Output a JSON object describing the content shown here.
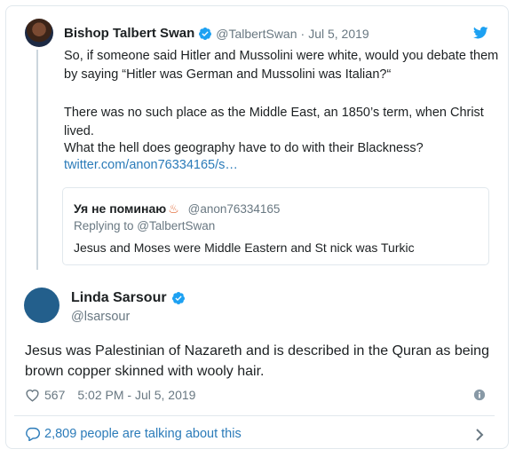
{
  "parent_tweet": {
    "name": "Bishop Talbert Swan",
    "handle": "@TalbertSwan",
    "separator": "·",
    "date": "Jul 5, 2019",
    "paragraphs": [
      "So, if someone said Hitler and Mussolini were white, would you debate them by saying “Hitler was German and Mussolini was Italian?“",
      "There was no such place as the Middle East, an 1850’s term, when Christ lived.",
      "What the hell does geography have to do with their Blackness?"
    ],
    "link": "twitter.com/anon76334165/s…"
  },
  "quoted_tweet": {
    "name": "Уя не поминаю",
    "emoji": "♨",
    "handle": "@anon76334165",
    "replying_to": "Replying to @TalbertSwan",
    "text": "Jesus and Moses were Middle Eastern and St nick was Turkic"
  },
  "main_tweet": {
    "name": "Linda Sarsour",
    "handle": "@lsarsour",
    "text": "Jesus was Palestinian of Nazareth and is described in the Quran as being brown copper skinned with wooly hair.",
    "likes": "567",
    "timestamp": "5:02 PM - Jul 5, 2019"
  },
  "footer": {
    "talking": "2,809 people are talking about this"
  },
  "colors": {
    "link": "#2b7bb9",
    "verified": "#1da1f2",
    "muted": "#697882",
    "avatar_main": "#235f8c"
  }
}
